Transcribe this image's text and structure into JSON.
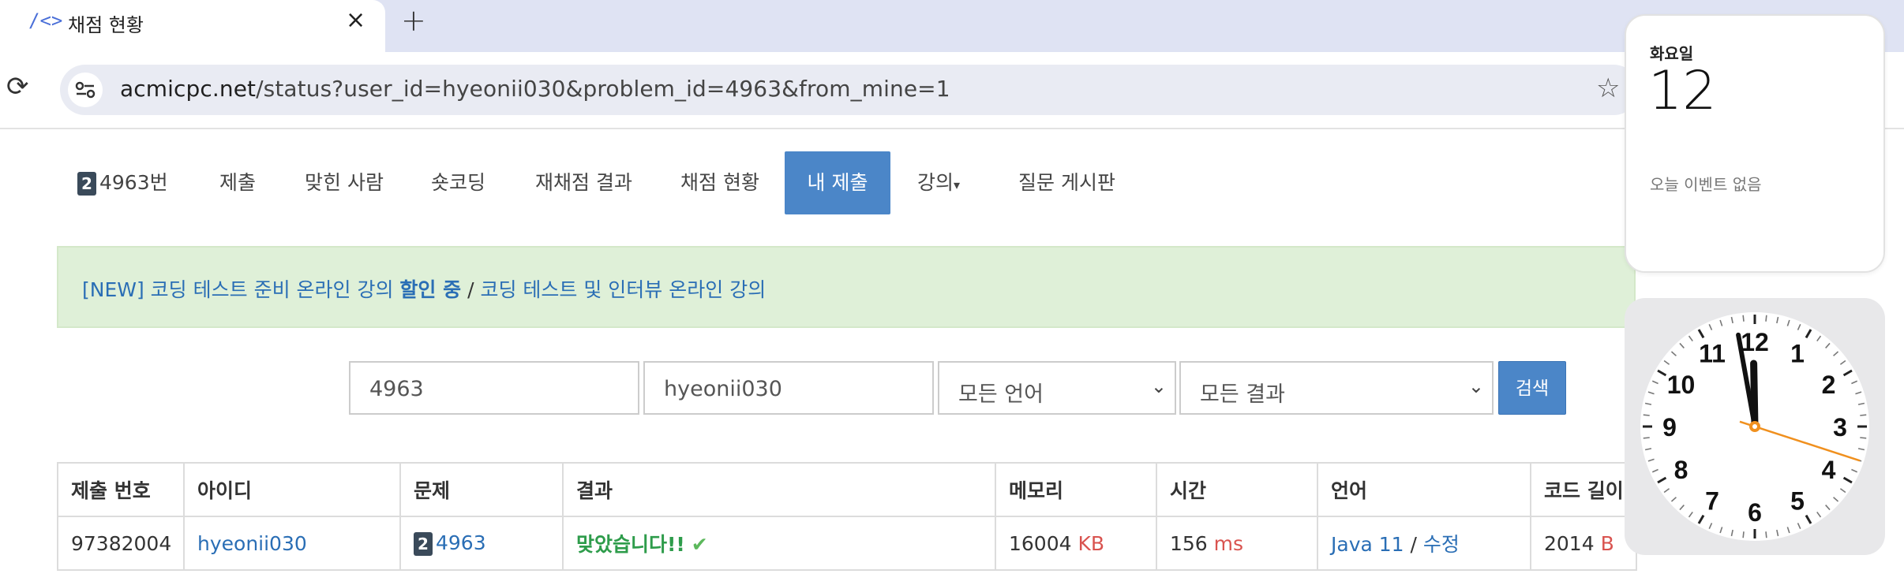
{
  "browser": {
    "tab_title": "채점 현황",
    "tab_favicon": "code-brackets-icon",
    "tab_close": "×",
    "new_tab": "+",
    "url_host": "acmicpc.net",
    "url_path": "/status?user_id=hyeonii030&problem_id=4963&from_mine=1"
  },
  "nav": {
    "problem_badge": "2",
    "items": [
      "4963번",
      "제출",
      "맞힌 사람",
      "숏코딩",
      "재채점 결과",
      "채점 현황",
      "내 제출",
      "강의",
      "질문 게시판"
    ],
    "active_index": 6,
    "caret": "▾"
  },
  "alert": {
    "part1": "[NEW] 코딩 테스트 준비 온라인 강의 ",
    "bold": "할인 중",
    "sep": " / ",
    "part2": "코딩 테스트 및 인터뷰 온라인 강의"
  },
  "search": {
    "problem_id": "4963",
    "user_id": "hyeonii030",
    "language": "모든 언어",
    "result": "모든 결과",
    "button": "검색"
  },
  "table": {
    "headers": [
      "제출 번호",
      "아이디",
      "문제",
      "결과",
      "메모리",
      "시간",
      "언어",
      "코드 길이"
    ],
    "row": {
      "submission_id": "97382004",
      "user": "hyeonii030",
      "problem_badge": "2",
      "problem": "4963",
      "result": "맞았습니다!!",
      "result_mark": "✔",
      "memory": "16004",
      "memory_unit": "KB",
      "time": "156",
      "time_unit": "ms",
      "language": "Java 11",
      "lang_sep": " / ",
      "edit": "수정",
      "code_length": "2014",
      "code_unit": "B"
    }
  },
  "calendar_widget": {
    "weekday": "화요일",
    "day": "12",
    "no_events": "오늘 이벤트 없음"
  },
  "clock_widget": {
    "hour": 11,
    "minute": 58,
    "second": 18,
    "numbers": [
      "12",
      "1",
      "2",
      "3",
      "4",
      "5",
      "6",
      "7",
      "8",
      "9",
      "10",
      "11"
    ]
  },
  "colors": {
    "accent": "#4b86c8",
    "link": "#2a6eb5",
    "success": "#2e9c4b",
    "unit_red": "#d9534f",
    "alert_bg": "#dff0d8",
    "second_hand": "#f0901e"
  }
}
